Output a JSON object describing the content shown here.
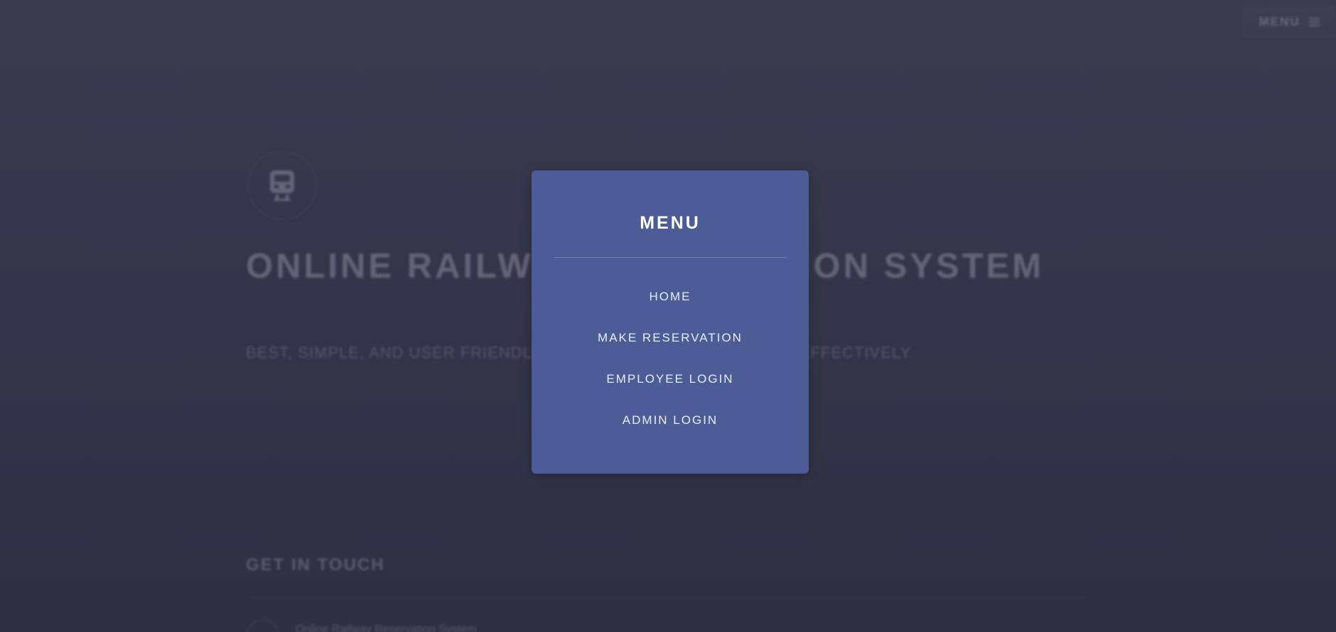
{
  "header": {
    "menu_label": "MENU"
  },
  "hero": {
    "title": "ONLINE RAILWAY RESERVATION SYSTEM",
    "subtitle": "BEST, SIMPLE, AND USER FRIENDLY WAY TO BOOK TRAIN TICKETS EFFECTIVELY"
  },
  "footer": {
    "title": "GET IN TOUCH",
    "item": "Online Railway Reservation System"
  },
  "modal": {
    "title": "MENU",
    "items": [
      {
        "label": "HOME"
      },
      {
        "label": "MAKE RESERVATION"
      },
      {
        "label": "EMPLOYEE LOGIN"
      },
      {
        "label": "ADMIN LOGIN"
      }
    ]
  },
  "colors": {
    "background": "#33354a",
    "modal": "#4c5c97",
    "modal_text": "#ffffff"
  },
  "icons": {
    "logo": "train-icon",
    "menu": "hamburger-icon"
  }
}
